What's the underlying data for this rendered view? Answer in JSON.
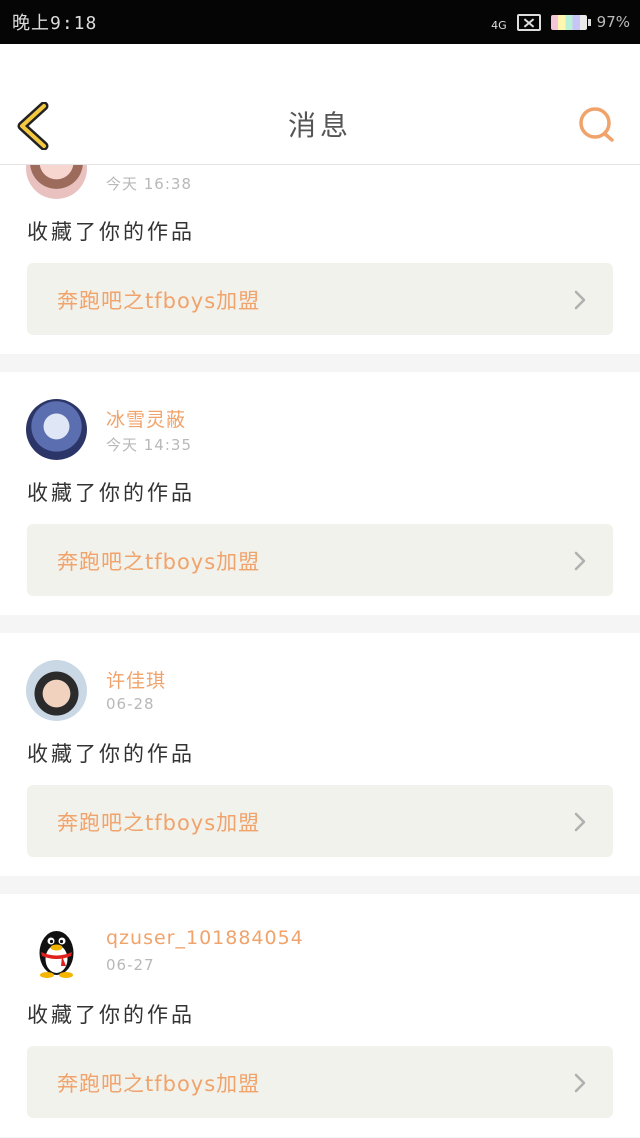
{
  "status_bar": {
    "time": "晚上9:18",
    "network": "4G",
    "battery": "97%"
  },
  "header": {
    "title": "消息",
    "back_icon": "chevron-left-icon",
    "search_icon": "search-icon",
    "accent_color": "#f0a36b"
  },
  "notifications": [
    {
      "username": "",
      "time": "今天 16:38",
      "action": "收藏了你的作品",
      "work": "奔跑吧之tfboys加盟"
    },
    {
      "username": "冰雪灵蔽",
      "time": "今天 14:35",
      "action": "收藏了你的作品",
      "work": "奔跑吧之tfboys加盟"
    },
    {
      "username": "许佳琪",
      "time": "06-28",
      "action": "收藏了你的作品",
      "work": "奔跑吧之tfboys加盟"
    },
    {
      "username": "qzuser_101884054",
      "time": "06-27",
      "action": "收藏了你的作品",
      "work": "奔跑吧之tfboys加盟"
    }
  ]
}
